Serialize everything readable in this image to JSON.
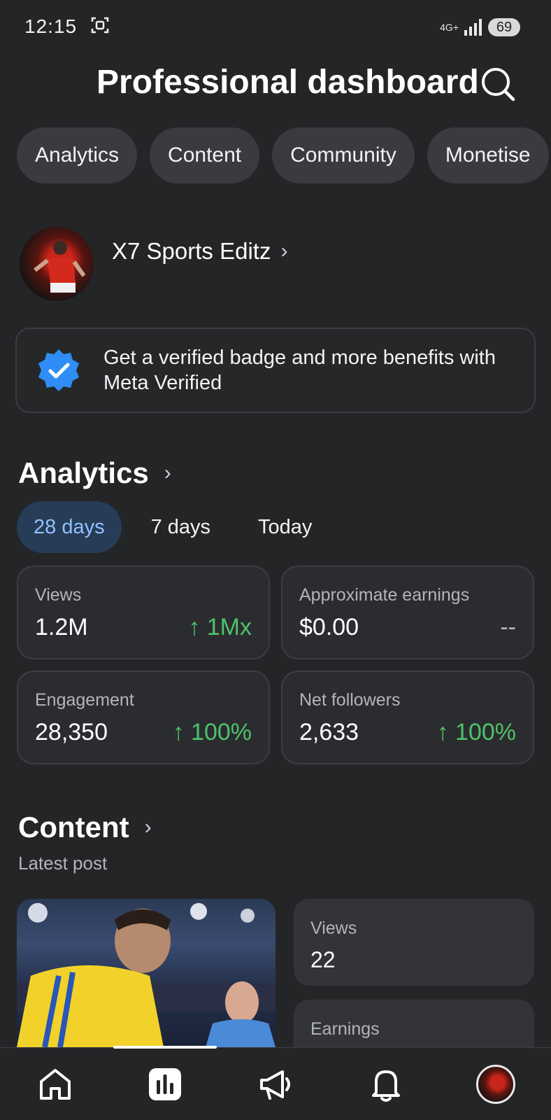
{
  "status_bar": {
    "time": "12:15",
    "network": "4G+",
    "battery": "69"
  },
  "header": {
    "title": "Professional dashboard",
    "search_icon": "search-icon"
  },
  "chips": [
    "Analytics",
    "Content",
    "Community",
    "Monetise"
  ],
  "profile": {
    "name": "X7 Sports Editz"
  },
  "verified_banner": {
    "text": "Get a verified badge and more benefits with Meta Verified",
    "badge_color": "#2f8df5"
  },
  "analytics": {
    "title": "Analytics",
    "periods": [
      "28 days",
      "7 days",
      "Today"
    ],
    "active_period": "28 days",
    "stats": [
      {
        "label": "Views",
        "value": "1.2M",
        "change": "↑ 1Mx"
      },
      {
        "label": "Approximate earnings",
        "value": "$0.00",
        "change": "--"
      },
      {
        "label": "Engagement",
        "value": "28,350",
        "change": "↑ 100%"
      },
      {
        "label": "Net followers",
        "value": "2,633",
        "change": "↑ 100%"
      }
    ]
  },
  "content": {
    "title": "Content",
    "subtitle": "Latest post",
    "post_stats": [
      {
        "label": "Views",
        "value": "22"
      },
      {
        "label": "Earnings",
        "value": ""
      }
    ]
  },
  "colors": {
    "background": "#242527",
    "accent": "#8fc2ff",
    "positive": "#4fc26a"
  },
  "bottom_nav": [
    "home-icon",
    "dashboard-icon",
    "megaphone-icon",
    "bell-icon",
    "profile-avatar"
  ]
}
